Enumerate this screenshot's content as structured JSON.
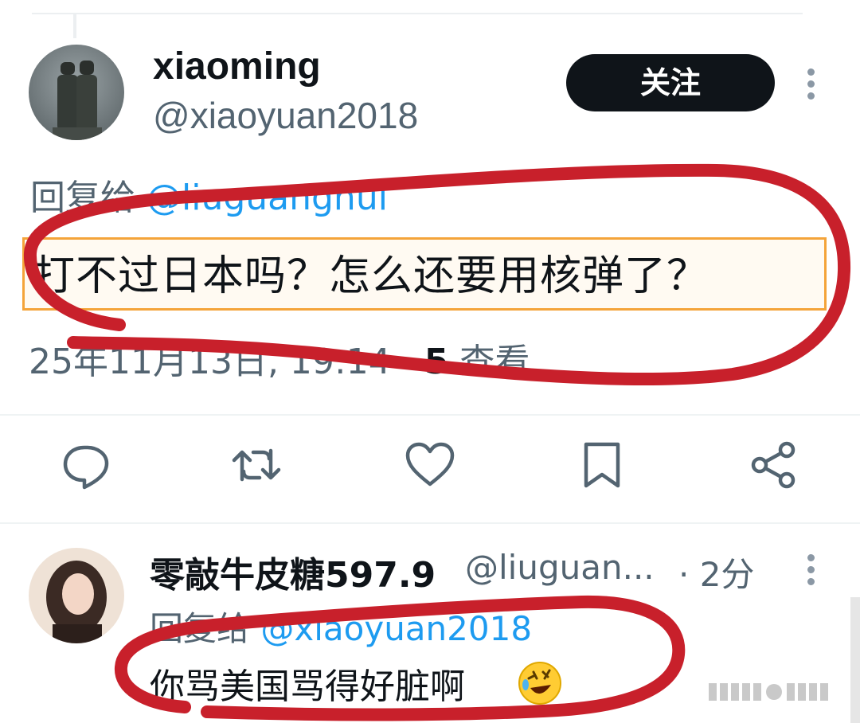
{
  "tweet": {
    "author_name": "xiaoming",
    "author_handle": "@xiaoyuan2018",
    "follow_label": "关注",
    "reply_prefix": "回复给",
    "reply_to": "@liuguanghui",
    "text": "打不过日本吗？怎么还要用核弹了？",
    "date": "25年11月13日, 19:14 · ",
    "views_count": "5",
    "views_label": " 查看"
  },
  "actions": [
    "reply-icon",
    "retweet-icon",
    "like-icon",
    "bookmark-icon",
    "share-icon"
  ],
  "reply": {
    "author_name": "零敲牛皮糖597.9",
    "author_handle": "@liuguan...",
    "time": " · 2分",
    "reply_prefix": "回复给",
    "reply_to": "@xiaoyuan2018",
    "text": "你骂美国骂得好脏啊",
    "emoji": "rolling-on-floor-laughing-emoji"
  },
  "colors": {
    "accent": "#1d9bf0",
    "follow_button": "#0f1419",
    "annotation_red": "#c8202b",
    "highlight_border": "#f4a43a"
  }
}
